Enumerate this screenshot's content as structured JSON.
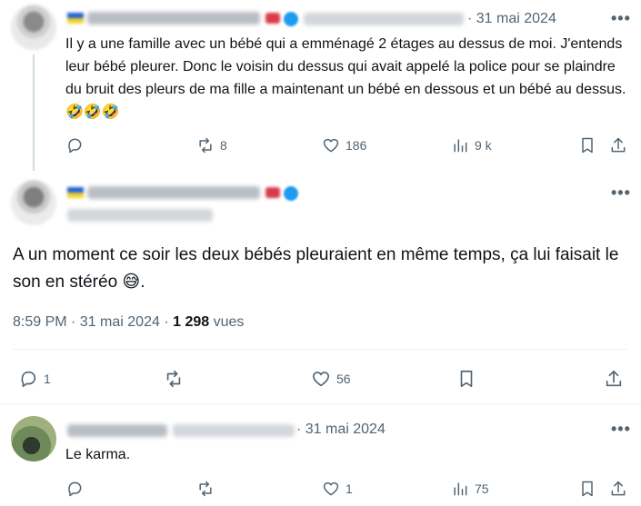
{
  "tweet1": {
    "date": "· 31 mai 2024",
    "text": "Il y a une famille avec un bébé qui a emménagé 2 étages au dessus de moi. J'entends leur bébé pleurer. Donc le voisin du dessus qui avait appelé la police pour se plaindre du bruit des pleurs de ma fille a maintenant un bébé en dessous et un bébé au dessus.",
    "emoji": "🤣🤣🤣",
    "actions": {
      "reply": "",
      "retweet": "8",
      "like": "186",
      "views": "9 k"
    }
  },
  "tweet2": {
    "text": "A un moment ce soir les deux bébés pleuraient en même temps, ça lui faisait le son en stéréo",
    "emoji": "😅",
    "text_end": ".",
    "time": "8:59 PM · 31 mai 2024 · ",
    "views_count": "1 298",
    "views_label": " vues",
    "actions": {
      "reply": "1",
      "retweet": "",
      "like": "56"
    }
  },
  "tweet3": {
    "date": "· 31 mai 2024",
    "text": "Le karma.",
    "actions": {
      "reply": "",
      "retweet": "",
      "like": "1",
      "views": "75"
    }
  },
  "more_label": "•••",
  "colors": {
    "text": "#0f1419",
    "muted": "#536471",
    "verified": "#1d9bf0",
    "divider": "#eff3f4"
  },
  "icons": [
    "reply-icon",
    "retweet-icon",
    "like-icon",
    "views-icon",
    "bookmark-icon",
    "share-icon",
    "more-icon",
    "verified-icon"
  ]
}
